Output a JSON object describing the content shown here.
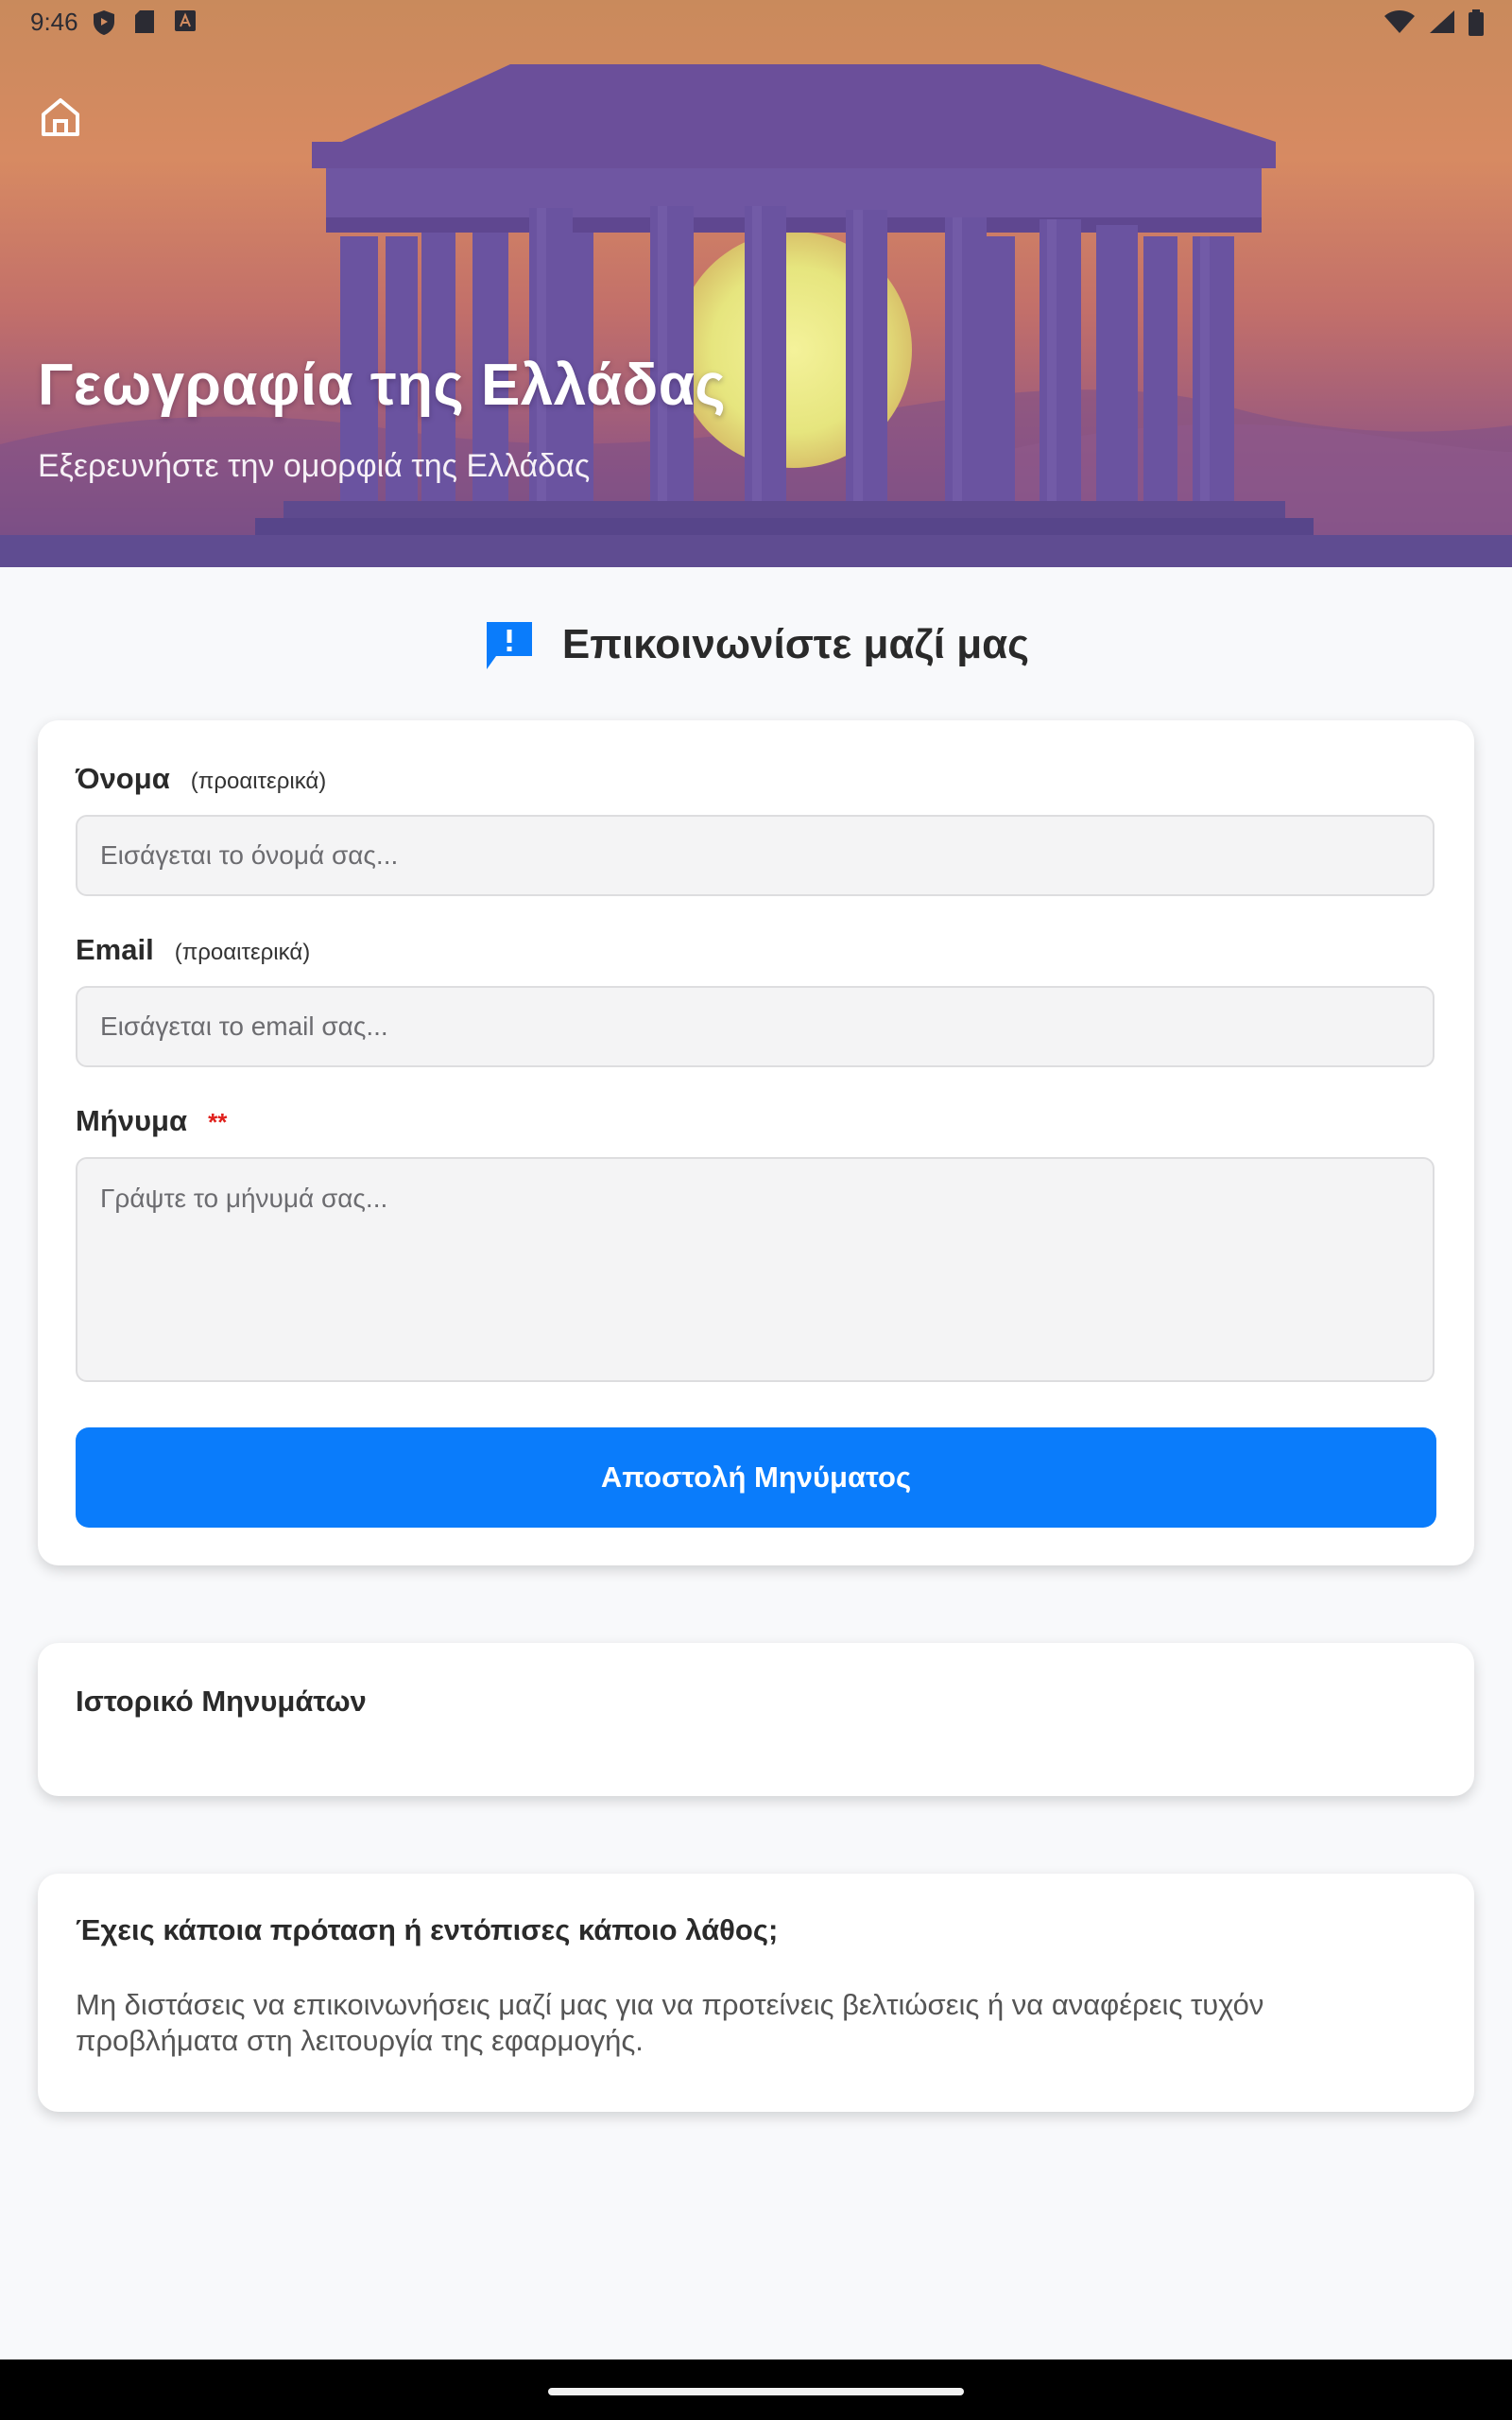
{
  "status_bar": {
    "time": "9:46",
    "left_icons": [
      "shield-icon",
      "sd-card-icon",
      "font-a-icon"
    ],
    "right_icons": [
      "wifi-icon",
      "signal-icon",
      "battery-icon"
    ]
  },
  "hero": {
    "title": "Γεωγραφία της Ελλάδας",
    "subtitle": "Εξερευνήστε την ομορφιά της Ελλάδας",
    "home_icon": "home-icon"
  },
  "contact": {
    "title": "Επικοινωνίστε μαζί μας",
    "icon": "feedback-message-icon",
    "accent_color": "#0a7cfb"
  },
  "form": {
    "name": {
      "label": "Όνομα",
      "hint": "(προαιτερικά)",
      "placeholder": "Εισάγεται το όνομά σας...",
      "value": ""
    },
    "email": {
      "label": "Email",
      "hint": "(προαιτερικά)",
      "placeholder": "Εισάγεται το email σας...",
      "value": ""
    },
    "message": {
      "label": "Μήνυμα",
      "required_mark": "**",
      "placeholder": "Γράψτε το μήνυμά σας...",
      "value": ""
    },
    "submit_label": "Αποστολή Μηνύματος"
  },
  "history": {
    "title": "Ιστορικό Μηνυμάτων"
  },
  "feedback": {
    "title": "Έχεις κάποια πρόταση ή εντόπισες κάποιο λάθος;",
    "text": "Μη διστάσεις να επικοινωνήσεις μαζί μας για να προτείνεις βελτιώσεις ή να αναφέρεις τυχόν προβλήματα στη λειτουργία της εφαρμογής."
  }
}
